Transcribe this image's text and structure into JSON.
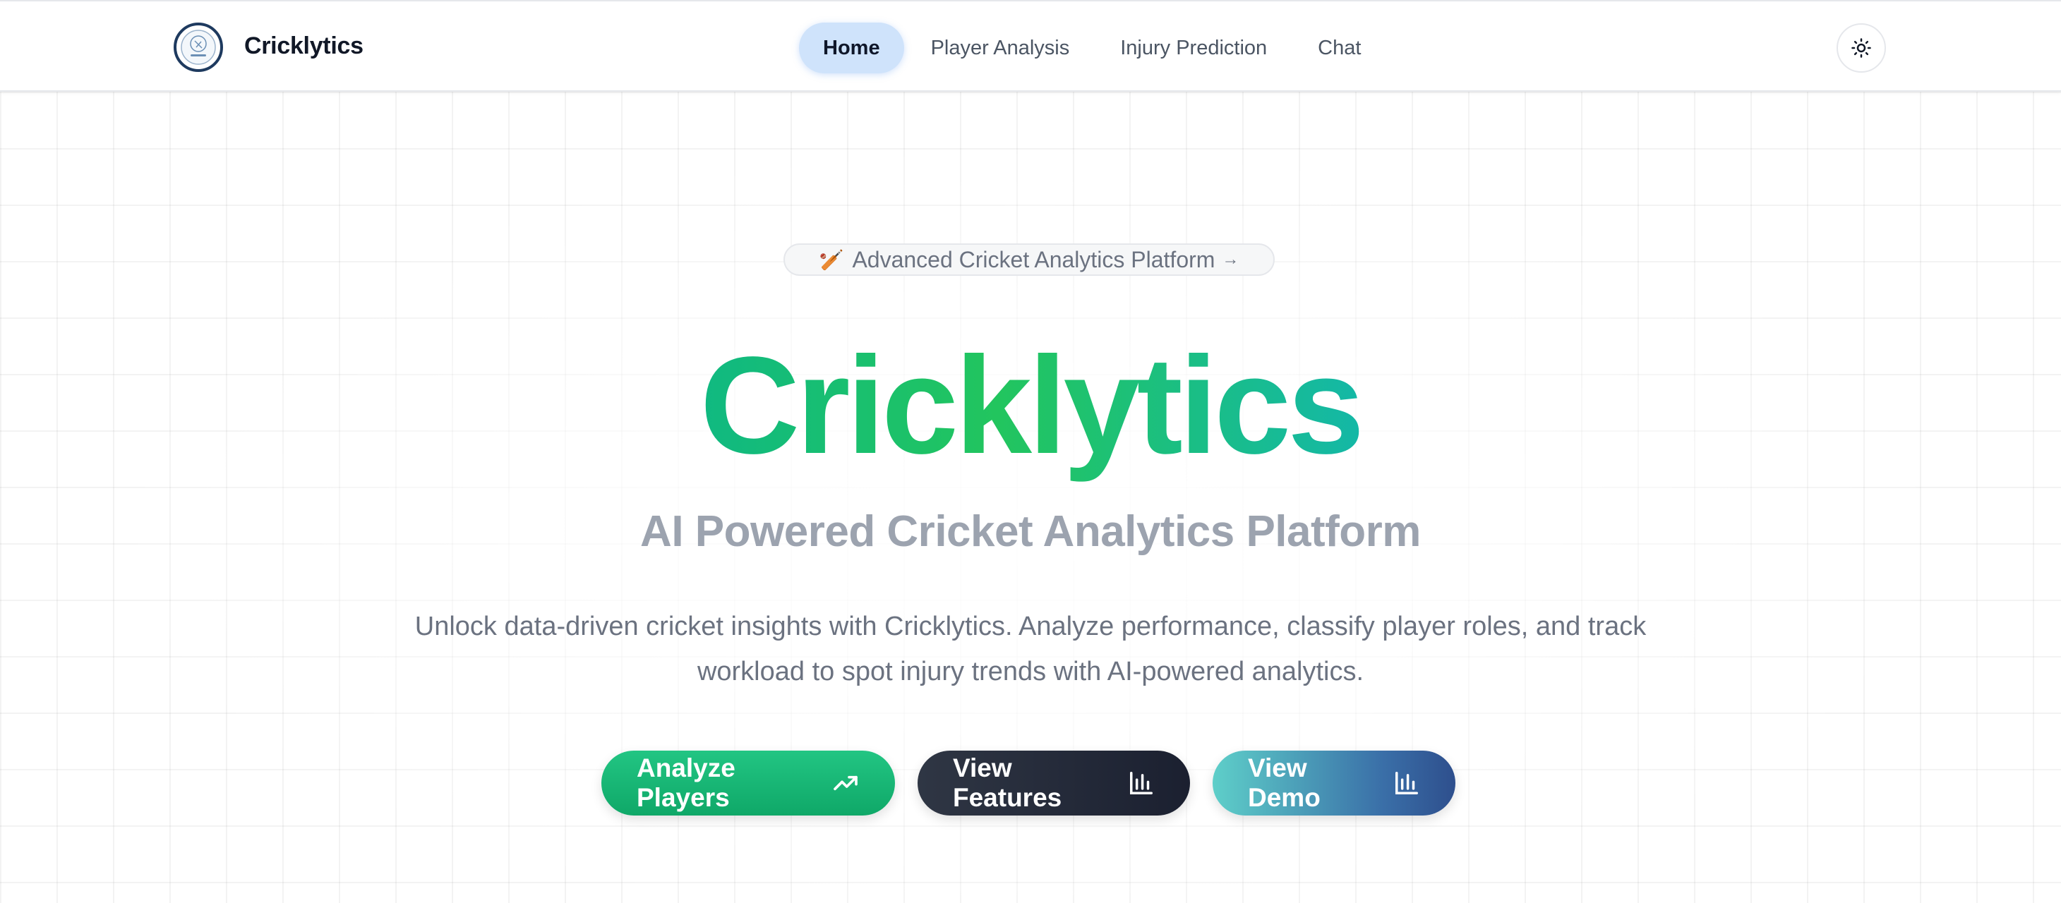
{
  "navbar": {
    "brand": "Cricklytics",
    "links": [
      {
        "label": "Home",
        "active": true
      },
      {
        "label": "Player Analysis",
        "active": false
      },
      {
        "label": "Injury Prediction",
        "active": false
      },
      {
        "label": "Chat",
        "active": false
      }
    ],
    "theme_toggle_icon": "sun-icon"
  },
  "hero": {
    "badge_emoji": "🏏",
    "badge_text": "Advanced Cricket Analytics Platform",
    "badge_arrow": "→",
    "title": "Cricklytics",
    "subtitle": "AI Powered Cricket Analytics Platform",
    "description": "Unlock data-driven cricket insights with Cricklytics. Analyze performance, classify player roles, and track workload to spot injury trends with AI-powered analytics.",
    "buttons": [
      {
        "label": "Analyze Players",
        "icon": "trending-up-icon"
      },
      {
        "label": "View Features",
        "icon": "bar-chart-icon"
      },
      {
        "label": "View Demo",
        "icon": "bar-chart-icon"
      }
    ]
  },
  "colors": {
    "brand_green": "#22c55e",
    "title_gradient_start": "#10b981",
    "title_gradient_end": "#14b8a6",
    "nav_active_bg": "#cfe3fb",
    "dark_button": "#1f2937",
    "demo_gradient_start": "#5ecfc9",
    "demo_gradient_end": "#2e4f8d"
  }
}
